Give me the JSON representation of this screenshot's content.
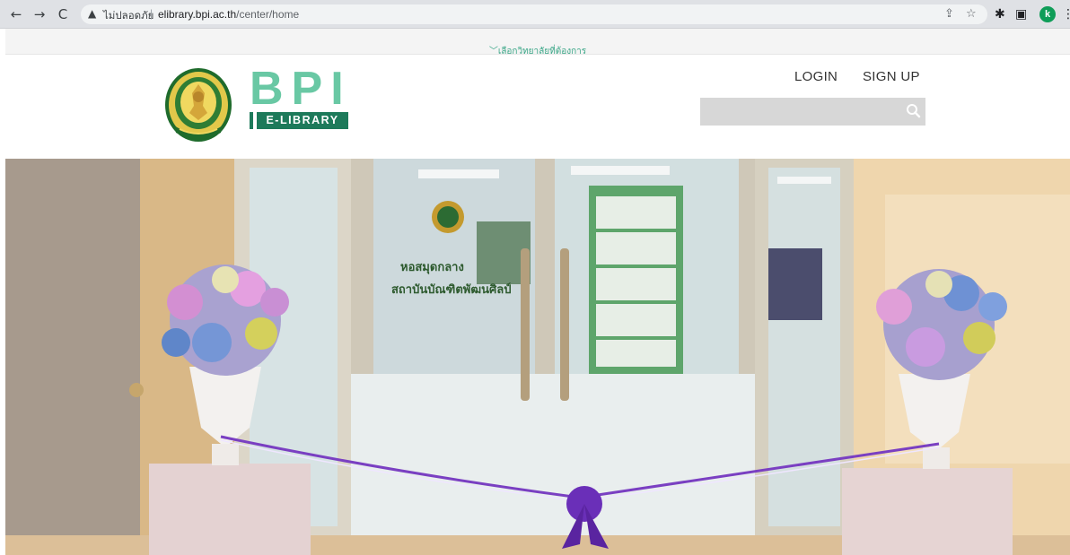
{
  "browser": {
    "security_label": "ไม่ปลอดภัย",
    "url_host": "elibrary.bpi.ac.th",
    "url_path": "/center/home",
    "profile_initial": "k"
  },
  "subject_bar": {
    "label": "เลือกวิทยาลัยที่ต้องการ"
  },
  "header": {
    "brand_title": "BPI",
    "brand_subtitle": "E-LIBRARY",
    "login_label": "LOGIN",
    "signup_label": "SIGN UP",
    "search_placeholder": ""
  },
  "hero": {
    "door_sign_line1": "หอสมุดกลาง",
    "door_sign_line2": "สถาบันบัณฑิตพัฒนศิลป์"
  },
  "colors": {
    "brand_green": "#69c8a4",
    "brand_dark": "#1d7a5a",
    "subject_text": "#3aa687",
    "search_bg": "#d7d7d7"
  }
}
